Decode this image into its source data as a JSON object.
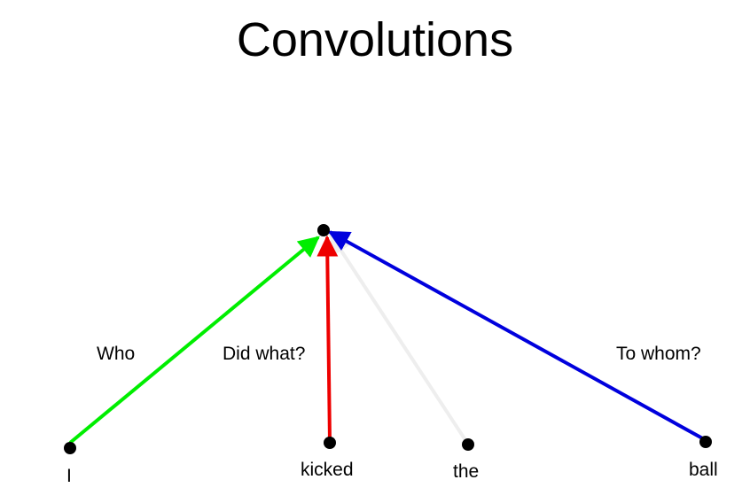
{
  "title": "Convolutions",
  "words": [
    "I",
    "kicked",
    "the",
    "ball"
  ],
  "edge_labels": {
    "who": "Who",
    "did_what": "Did what?",
    "to_whom": "To whom?"
  },
  "colors": {
    "who": "#00ee00",
    "did_what": "#ee0000",
    "the": "#eeeeee",
    "to_whom": "#0000dd",
    "node": "#000000"
  }
}
